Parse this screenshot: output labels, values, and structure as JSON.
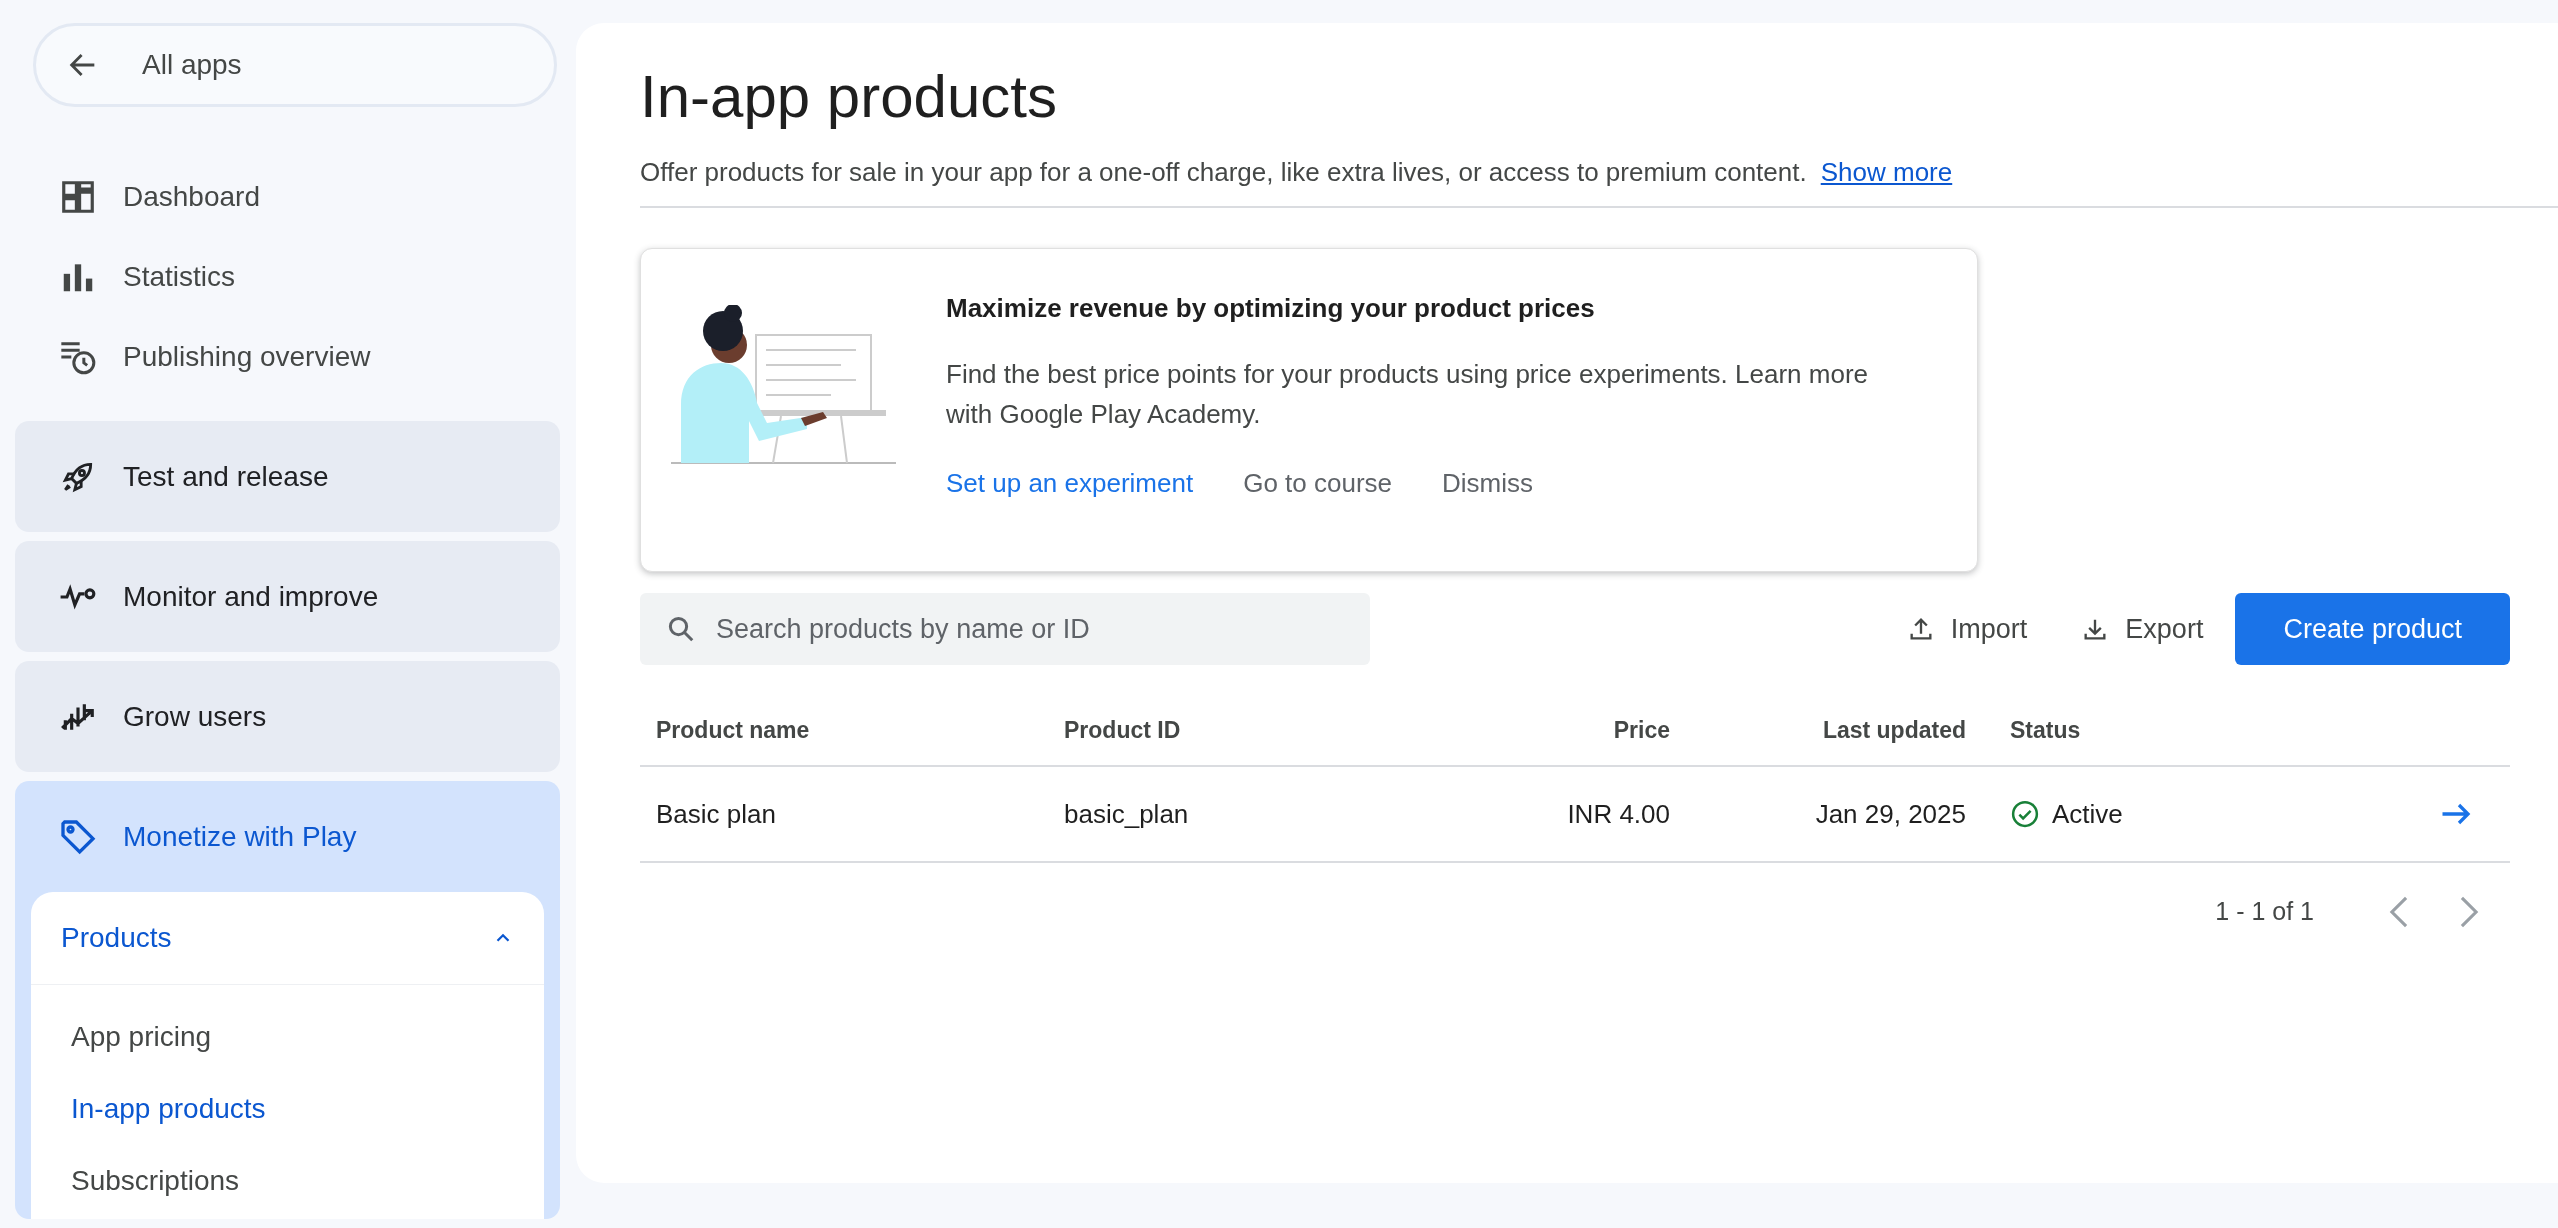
{
  "sidebar": {
    "back_label": "All apps",
    "items": [
      {
        "kind": "link",
        "label": "Dashboard"
      },
      {
        "kind": "link",
        "label": "Statistics"
      },
      {
        "kind": "link",
        "label": "Publishing overview"
      },
      {
        "kind": "section",
        "label": "Test and release",
        "expanded": false
      },
      {
        "kind": "section",
        "label": "Monitor and improve",
        "expanded": false
      },
      {
        "kind": "section",
        "label": "Grow users",
        "expanded": false
      },
      {
        "kind": "section",
        "label": "Monetize with Play",
        "expanded": true,
        "children": [
          {
            "label": "Products",
            "expanded": true,
            "children": [
              {
                "label": "App pricing",
                "selected": false
              },
              {
                "label": "In-app products",
                "selected": true
              },
              {
                "label": "Subscriptions",
                "selected": false
              }
            ]
          }
        ]
      }
    ]
  },
  "page": {
    "title": "In-app products",
    "subtitle": "Offer products for sale in your app for a one-off charge, like extra lives, or access to premium content.",
    "subtitle_link": "Show more"
  },
  "promo": {
    "title": "Maximize revenue by optimizing your product prices",
    "body": "Find the best price points for your products using price experiments. Learn more with Google Play Academy.",
    "actions": [
      {
        "kind": "primary",
        "label": "Set up an experiment"
      },
      {
        "kind": "secondary",
        "label": "Go to course"
      },
      {
        "kind": "secondary",
        "label": "Dismiss"
      }
    ]
  },
  "toolbar": {
    "search": {
      "placeholder": "Search products by name or ID"
    },
    "import": "Import",
    "export": "Export",
    "create": "Create product"
  },
  "table": {
    "columns": [
      "Product name",
      "Product ID",
      "Price",
      "Last updated",
      "Status"
    ],
    "rows": [
      {
        "cells": [
          "Basic plan",
          "basic_plan",
          "INR 4.00",
          "Jan 29, 2025"
        ],
        "status": "Active",
        "active": true
      }
    ]
  },
  "pagination": {
    "range": "1 - 1 of 1"
  }
}
